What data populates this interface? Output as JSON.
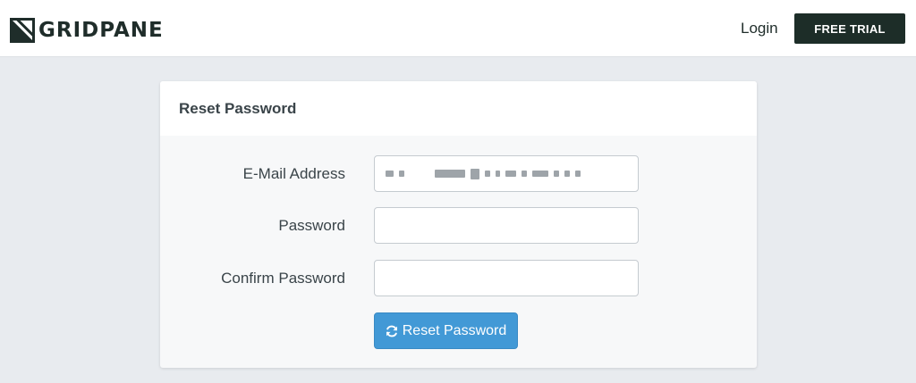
{
  "brand": {
    "name": "GRIDPANE",
    "color": "#1d2d28"
  },
  "nav": {
    "login_label": "Login",
    "trial_label": "FREE TRIAL"
  },
  "card": {
    "title": "Reset Password"
  },
  "form": {
    "email_label": "E-Mail Address",
    "email_value_masked": true,
    "password_label": "Password",
    "password_value": "",
    "confirm_label": "Confirm Password",
    "confirm_value": "",
    "submit_label": "Reset Password",
    "submit_icon": "refresh-icon",
    "accent_color": "#4299d6"
  }
}
